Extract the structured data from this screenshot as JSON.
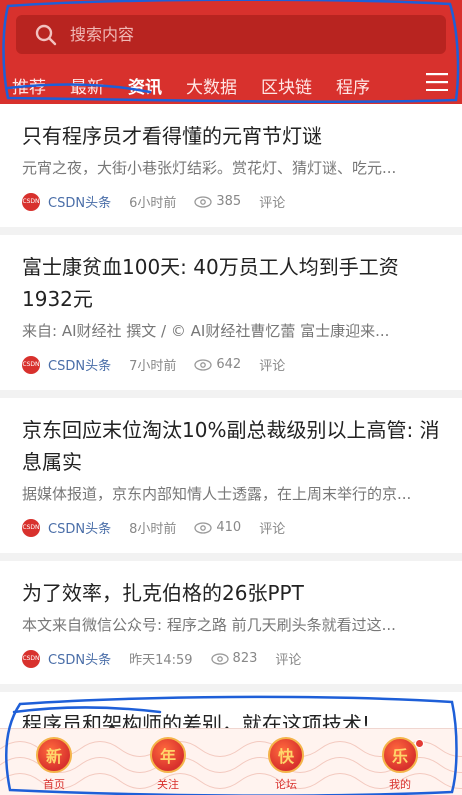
{
  "search": {
    "placeholder": "搜索内容"
  },
  "tabs": [
    {
      "label": "推荐"
    },
    {
      "label": "最新"
    },
    {
      "label": "资讯"
    },
    {
      "label": "大数据"
    },
    {
      "label": "区块链"
    },
    {
      "label": "程序"
    }
  ],
  "articles": [
    {
      "title": "只有程序员才看得懂的元宵节灯谜",
      "summary": "元宵之夜，大街小巷张灯结彩。赏花灯、猜灯谜、吃元...",
      "source": "CSDN头条",
      "time": "6小时前",
      "views": "385",
      "comment": "评论"
    },
    {
      "title": "富士康贫血100天: 40万员工人均到手工资1932元",
      "summary": "来自: AI财经社 撰文 /  ©  AI财经社曹忆蕾 富士康迎来...",
      "source": "CSDN头条",
      "time": "7小时前",
      "views": "642",
      "comment": "评论"
    },
    {
      "title": "京东回应末位淘汰10%副总裁级别以上高管: 消息属实",
      "summary": "据媒体报道，京东内部知情人士透露，在上周末举行的京...",
      "source": "CSDN头条",
      "time": "8小时前",
      "views": "410",
      "comment": "评论"
    },
    {
      "title": "为了效率，扎克伯格的26张PPT",
      "summary": "本文来自微信公众号: 程序之路 前几天刷头条就看过这...",
      "source": "CSDN头条",
      "time": "昨天14:59",
      "views": "823",
      "comment": "评论"
    },
    {
      "title": "程序员和架构师的差别，就在这项技术!",
      "summary": "",
      "source": "",
      "time": "",
      "views": "",
      "comment": ""
    }
  ],
  "logo_text": "CSDN",
  "bottom_nav": [
    {
      "glyph": "新",
      "label": "首页"
    },
    {
      "glyph": "年",
      "label": "关注"
    },
    {
      "glyph": "快",
      "label": "论坛"
    },
    {
      "glyph": "乐",
      "label": "我的"
    }
  ],
  "colors": {
    "brand": "#d8312d",
    "source": "#4a6ea8",
    "annotation": "#1e5fd8"
  }
}
